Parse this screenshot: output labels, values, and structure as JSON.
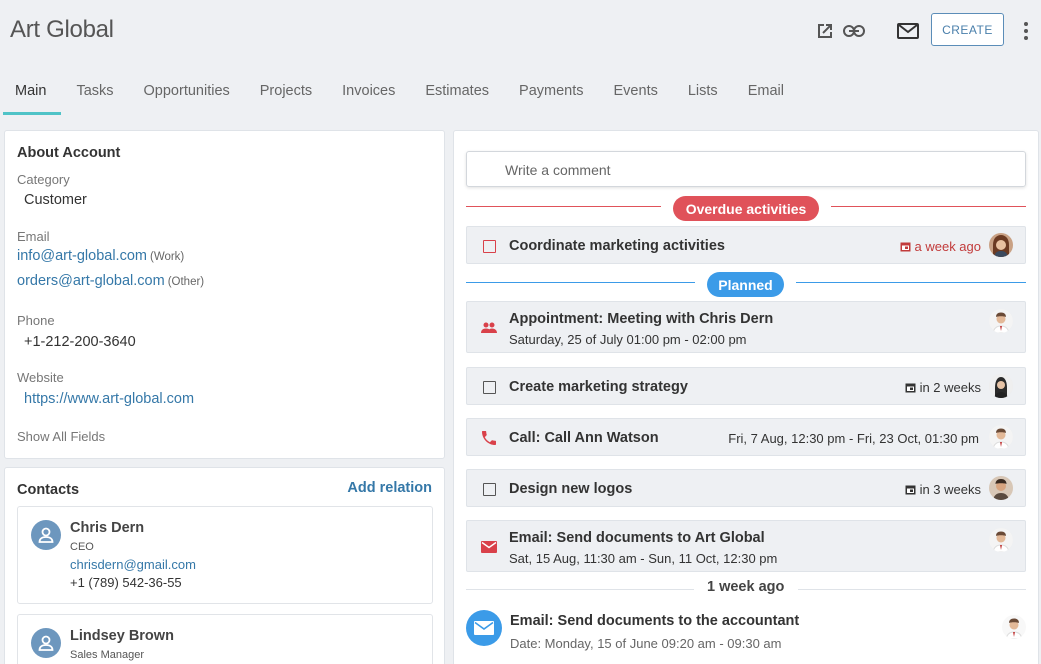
{
  "header": {
    "title": "Art Global",
    "create_label": "CREATE",
    "icons": [
      "open-external-icon",
      "link-icon",
      "mail-icon",
      "more-vertical-icon"
    ]
  },
  "tabs": [
    {
      "label": "Main",
      "active": true
    },
    {
      "label": "Tasks"
    },
    {
      "label": "Opportunities"
    },
    {
      "label": "Projects"
    },
    {
      "label": "Invoices"
    },
    {
      "label": "Estimates"
    },
    {
      "label": "Payments"
    },
    {
      "label": "Events"
    },
    {
      "label": "Lists"
    },
    {
      "label": "Email"
    }
  ],
  "about": {
    "heading": "About Account",
    "category_label": "Category",
    "category_value": "Customer",
    "email_label": "Email",
    "emails": [
      {
        "address": "info@art-global.com",
        "tag": "(Work)"
      },
      {
        "address": "orders@art-global.com",
        "tag": "(Other)"
      }
    ],
    "phone_label": "Phone",
    "phone_value": "+1-212-200-3640",
    "website_label": "Website",
    "website_value": "https://www.art-global.com",
    "show_all": "Show All Fields"
  },
  "contacts": {
    "heading": "Contacts",
    "add_relation": "Add relation",
    "items": [
      {
        "name": "Chris Dern",
        "role": "CEO",
        "email": "chrisdern@gmail.com",
        "phone": "+1 (789) 542-36-55"
      },
      {
        "name": "Lindsey Brown",
        "role": "Sales Manager"
      }
    ]
  },
  "stream": {
    "comment_placeholder": "Write a comment",
    "overdue_label": "Overdue activities",
    "planned_label": "Planned",
    "week_ago_label": "1 week ago",
    "colors": {
      "overdue": "#e0525a",
      "planned": "#3b9be8",
      "call": "#d9414a"
    },
    "overdue": [
      {
        "title": "Coordinate marketing activities",
        "when": "a week ago",
        "icon": "checkbox-icon"
      }
    ],
    "planned": [
      {
        "title": "Appointment: Meeting with Chris Dern",
        "sub": "Saturday, 25 of July 01:00 pm - 02:00 pm",
        "icon": "meeting-icon"
      },
      {
        "title": "Create marketing strategy",
        "when": "in 2 weeks",
        "icon": "checkbox-icon"
      },
      {
        "title": "Call: Call Ann Watson",
        "when": "Fri, 7 Aug, 12:30 pm - Fri, 23 Oct, 01:30 pm",
        "icon": "phone-icon"
      },
      {
        "title": "Design new logos",
        "when": "in 3 weeks",
        "icon": "checkbox-icon"
      },
      {
        "title": "Email: Send documents to Art Global",
        "sub": "Sat, 15 Aug, 11:30 am - Sun, 11 Oct, 12:30 pm",
        "icon": "email-icon"
      }
    ],
    "posts": [
      {
        "title": "Email: Send documents to the accountant",
        "sub": "Date: Monday, 15 of June 09:20 am - 09:30 am",
        "icon": "email-icon"
      }
    ]
  }
}
